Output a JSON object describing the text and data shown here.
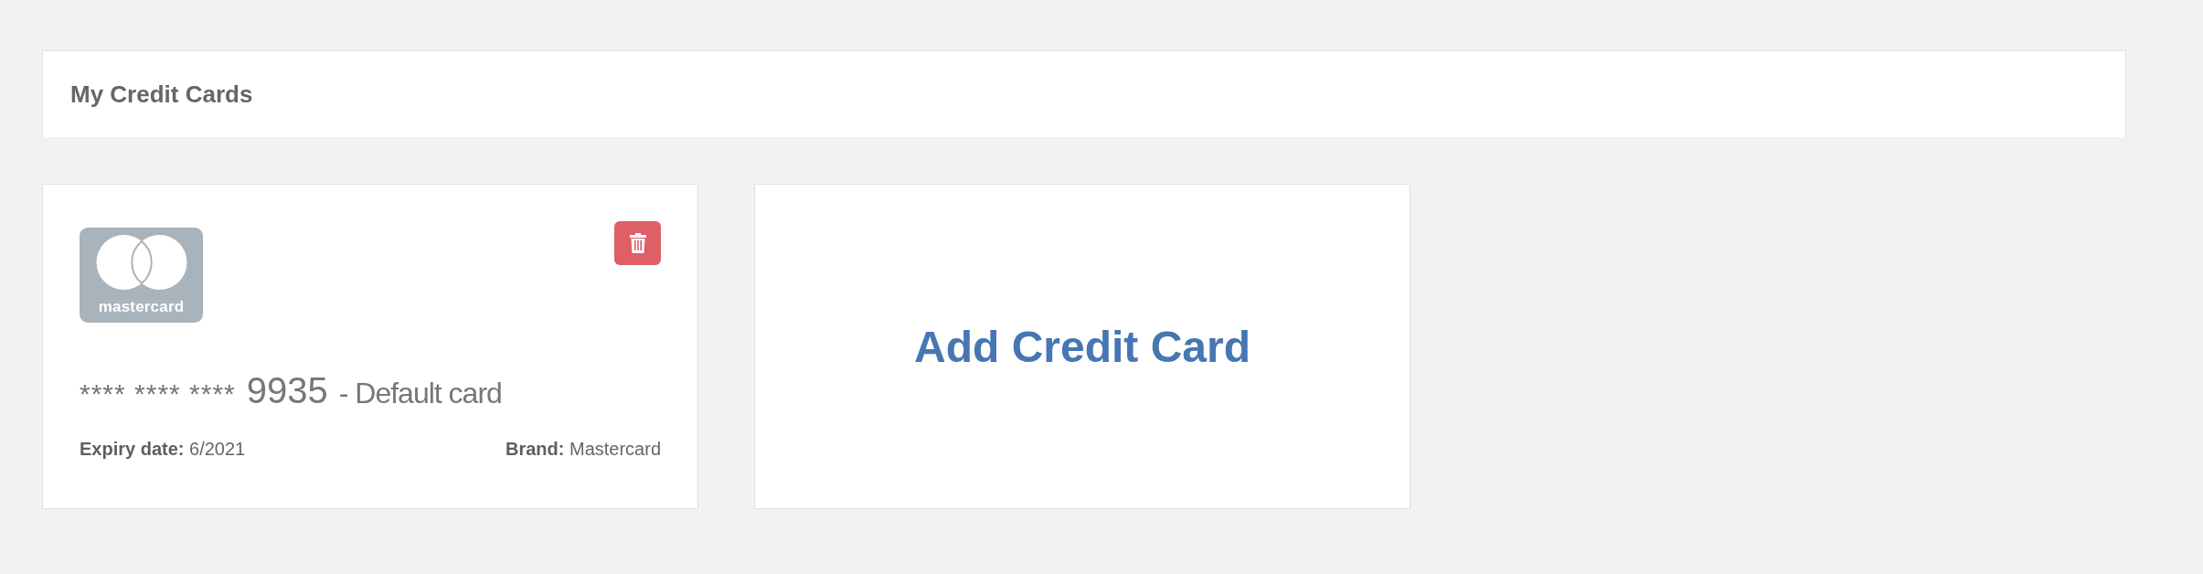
{
  "header": {
    "title": "My Credit Cards"
  },
  "cards": [
    {
      "logo_text": "mastercard",
      "masked": "**** **** ****",
      "last_digits": "9935",
      "default_label": "- Default card",
      "expiry_label": "Expiry date:",
      "expiry": "6/2021",
      "brand_label": "Brand:",
      "brand": "Mastercard"
    }
  ],
  "add_card": {
    "label": "Add Credit Card"
  }
}
